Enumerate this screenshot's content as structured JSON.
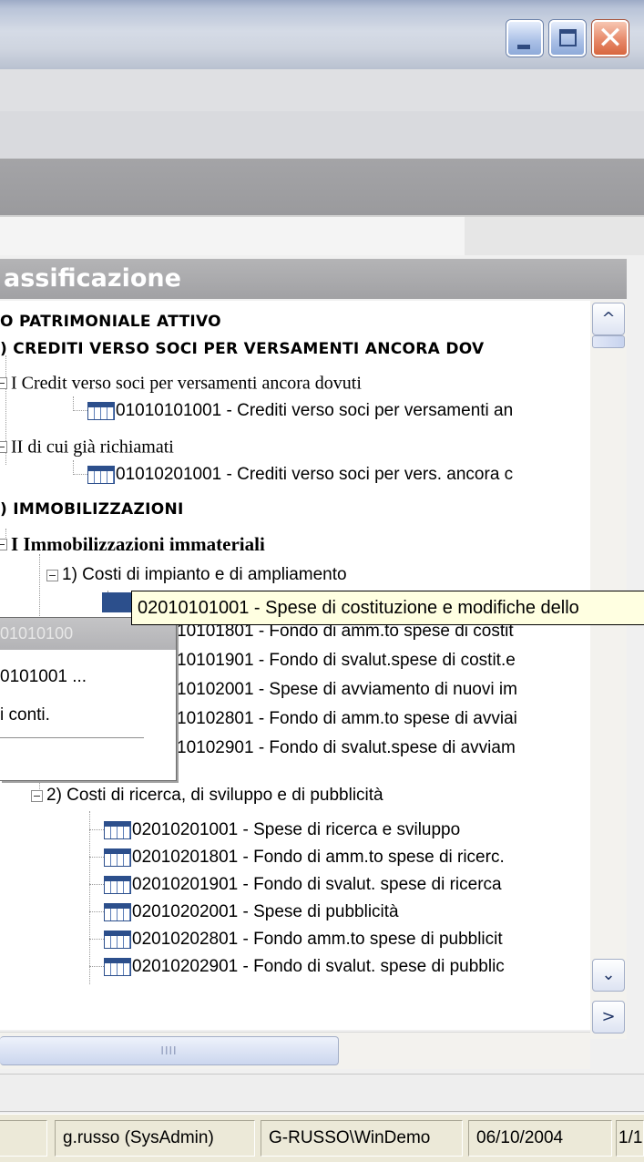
{
  "window": {
    "minimize_icon": "minimize-icon",
    "maximize_icon": "maximize-icon",
    "close_icon": "close-icon",
    "close_glyph": "✕"
  },
  "panel": {
    "header": "assificazione"
  },
  "tree": {
    "rows": [
      {
        "text": "O PATRIMONIALE ATTIVO"
      },
      {
        "text": ") CREDITI VERSO SOCI PER VERSAMENTI ANCORA DOV"
      },
      {
        "text": "I Credit verso soci per versamenti ancora dovuti"
      },
      {
        "text": "01010101001 - Crediti verso soci per versamenti an"
      },
      {
        "text": "II di cui già richiamati"
      },
      {
        "text": "01010201001 - Crediti verso soci per vers. ancora c"
      },
      {
        "text": ") IMMOBILIZZAZIONI"
      },
      {
        "text": "I Immobilizzazioni immateriali"
      },
      {
        "text": "1) Costi di impianto e di ampliamento"
      },
      {
        "text": "10101801 - Fondo di amm.to spese di costit"
      },
      {
        "text": "10101901 - Fondo di svalut.spese di costit.e"
      },
      {
        "text": "10102001 - Spese di avviamento di nuovi im"
      },
      {
        "text": "10102801 - Fondo di amm.to spese di avviai"
      },
      {
        "text": "10102901 - Fondo di svalut.spese di avviam"
      },
      {
        "text": "2) Costi di ricerca, di sviluppo e di pubblicità"
      },
      {
        "text": "02010201001 - Spese di ricerca e sviluppo"
      },
      {
        "text": "02010201801 - Fondo di amm.to spese di ricerc."
      },
      {
        "text": "02010201901 - Fondo di svalut. spese di ricerca"
      },
      {
        "text": "02010202001 - Spese di pubblicità"
      },
      {
        "text": "02010202801 - Fondo amm.to spese di pubblicit"
      },
      {
        "text": "02010202901 - Fondo di svalut. spese di pubblic"
      }
    ]
  },
  "tooltip": {
    "text": "02010101001 - Spese di costituzione e modifiche dello"
  },
  "context_menu": {
    "title": "01010100",
    "item1": "0101001 ...",
    "item2": "i conti."
  },
  "scrollbar": {
    "up": "^",
    "down": "⌄",
    "right": ">",
    "grip": "IIII"
  },
  "status": {
    "user": "g.russo (SysAdmin)",
    "workstation": "G-RUSSO\\WinDemo",
    "date": "06/10/2004",
    "page": "1/1"
  }
}
